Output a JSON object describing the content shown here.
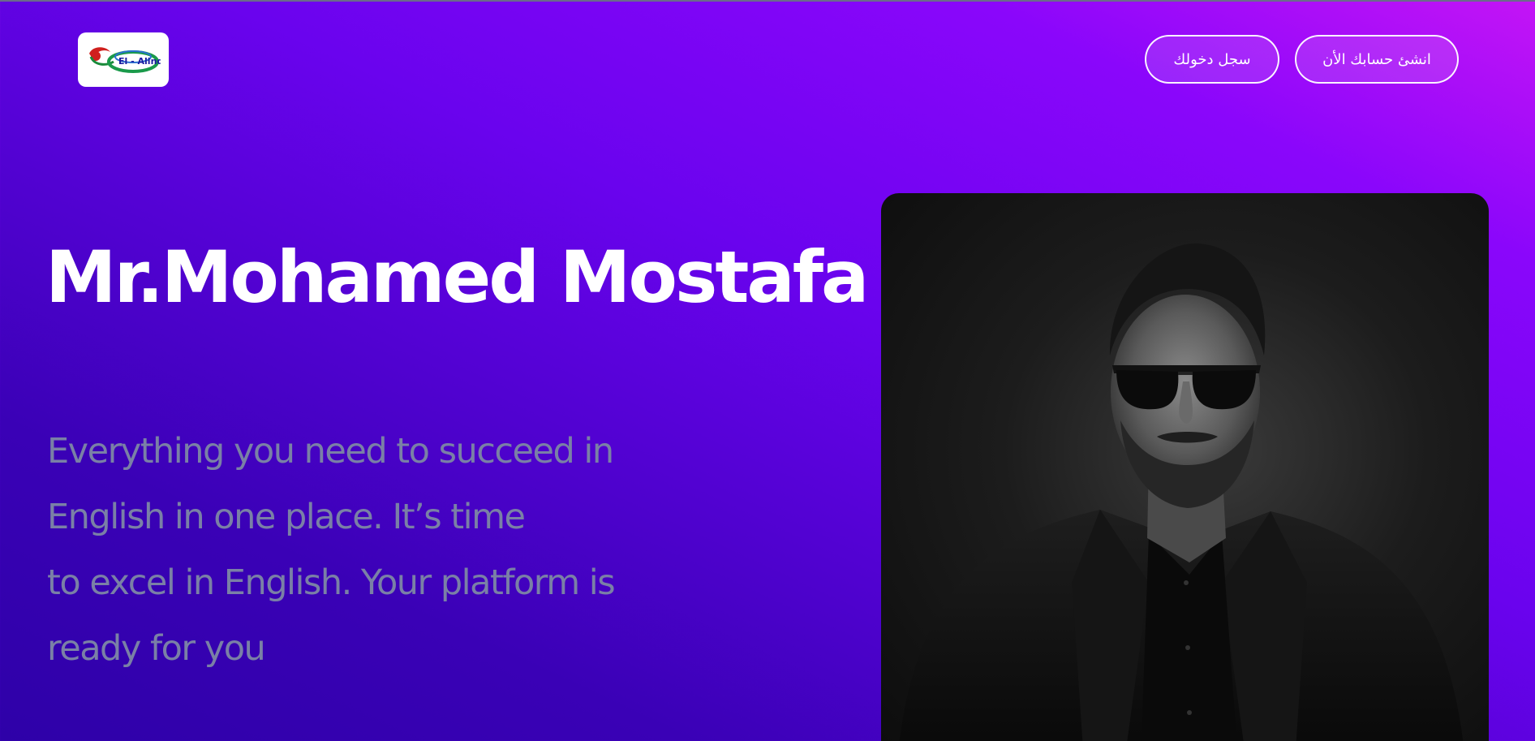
{
  "header": {
    "logo_alt": "El - Alind logo",
    "logo_text": "El - Alind",
    "register_label": "انشئ حسابك الأن",
    "login_label": "سجل دخولك"
  },
  "hero": {
    "title": "Mr.Mohamed Mostafa",
    "description_lines": [
      "Everything you need to succeed in",
      "English in one place. It’s time",
      "to excel in English. Your platform is",
      "ready for you"
    ]
  },
  "portrait": {
    "alt": "Portrait of Mr. Mohamed Mostafa in sunglasses and black suit"
  },
  "colors": {
    "gradient_start": "#c414f6",
    "gradient_mid": "#6a03ee",
    "gradient_end": "#2e01a8",
    "body_text": "#7a80a6"
  }
}
